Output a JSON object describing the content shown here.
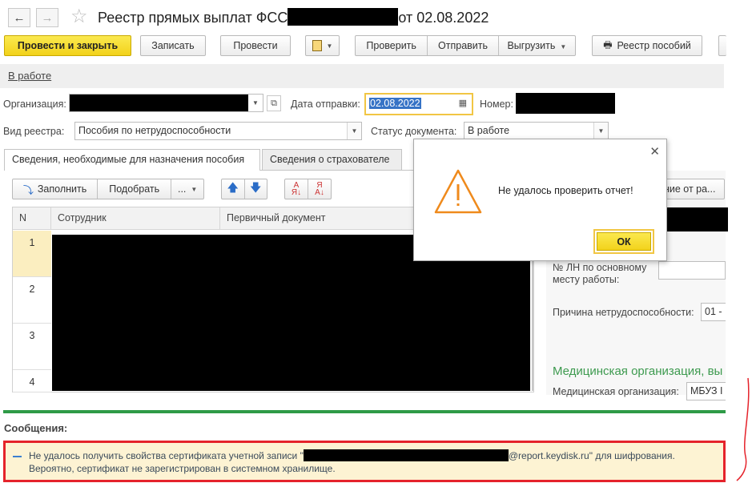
{
  "titlebar": {
    "back_icon": "arrow-left-icon",
    "forward_icon": "arrow-right-icon",
    "star_icon": "star-icon",
    "title_prefix": "Реестр прямых выплат ФСС",
    "title_suffix": "от 02.08.2022"
  },
  "toolbar": {
    "post_close": "Провести и закрыть",
    "save": "Записать",
    "post": "Провести",
    "check": "Проверить",
    "send": "Отправить",
    "export": "Выгрузить",
    "registry": "Реестр пособий"
  },
  "status_link": "В работе",
  "form": {
    "org_label": "Организация:",
    "send_date_label": "Дата отправки:",
    "send_date_value": "02.08.2022",
    "number_label": "Номер:",
    "registry_type_label": "Вид реестра:",
    "registry_type_value": "Пособия по нетрудоспособности",
    "doc_status_label": "Статус документа:",
    "doc_status_value": "В работе"
  },
  "tabs": [
    {
      "label": "Сведения, необходимые для назначения пособия",
      "active": true
    },
    {
      "label": "Сведения о страхователе",
      "active": false
    }
  ],
  "table_toolbar": {
    "fill": "Заполнить",
    "select": "Подобрать",
    "more": "..."
  },
  "table": {
    "columns": [
      "N",
      "Сотрудник",
      "Первичный документ"
    ],
    "rows": [
      "1",
      "2",
      "3",
      "4"
    ]
  },
  "right_panel": {
    "button_fragment": "ение от ра...",
    "ln_label_line1": "№ ЛН по основному",
    "ln_label_line2": "месту работы:",
    "reason_label": "Причина нетрудоспособности:",
    "reason_value": "01 -",
    "section_title": "Медицинская организация, вы",
    "med_org_label": "Медицинская организация:",
    "med_org_value": "МБУЗ I"
  },
  "dialog": {
    "message": "Не удалось проверить отчет!",
    "ok": "ОК",
    "icon": "warning-triangle-icon",
    "close_icon": "close-icon"
  },
  "messages": {
    "header": "Сообщения:",
    "line1_prefix": "Не удалось получить свойства сертификата учетной записи \"",
    "line1_suffix": "@report.keydisk.ru\" для шифрования.",
    "line2": "Вероятно, сертификат не зарегистрирован в системном хранилище."
  },
  "colors": {
    "accent_yellow": "#f2d21b",
    "highlight_red": "#e5232b",
    "green_separator": "#2e9a47",
    "section_green": "#3d9a4f",
    "warning_orange": "#ef8a1c"
  }
}
